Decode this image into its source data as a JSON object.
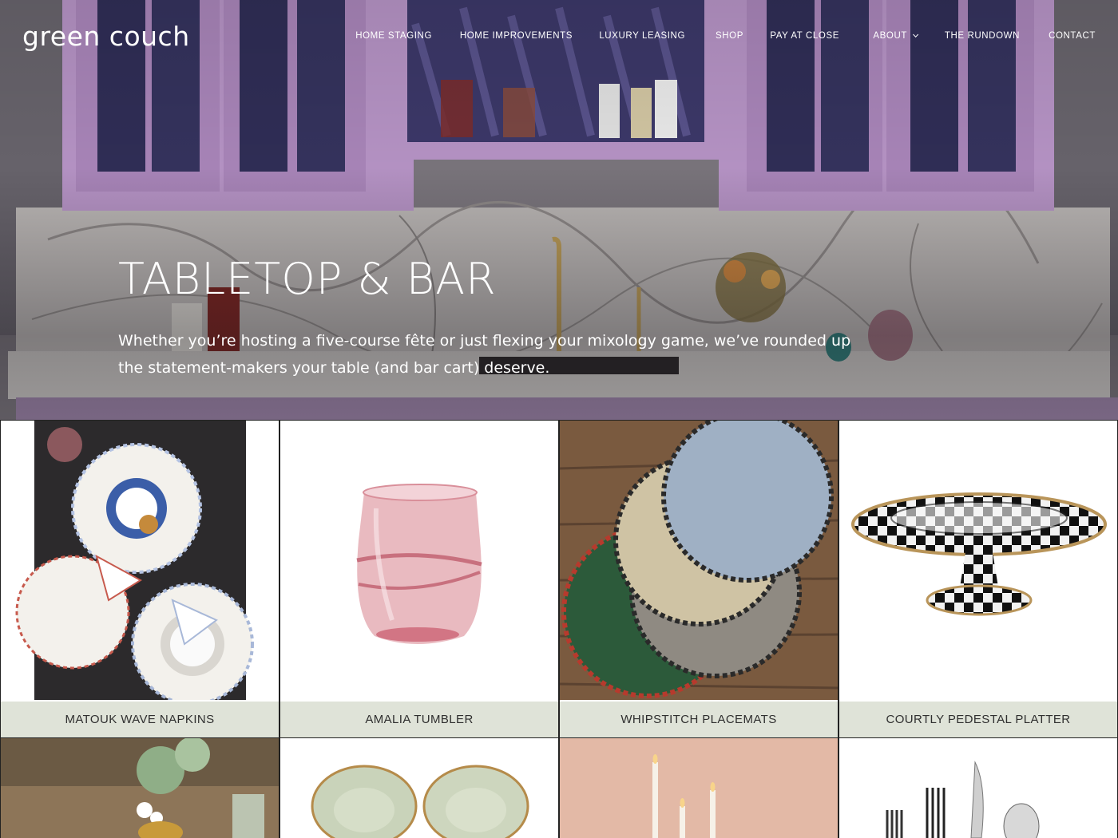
{
  "brand": {
    "logo_text": "green couch"
  },
  "nav": {
    "items": [
      {
        "label": "HOME STAGING"
      },
      {
        "label": "HOME IMPROVEMENTS"
      },
      {
        "label": "LUXURY LEASING"
      },
      {
        "label": "SHOP"
      },
      {
        "label": "PAY AT CLOSE"
      },
      {
        "label": "ABOUT",
        "has_dropdown": true
      },
      {
        "label": "THE RUNDOWN"
      },
      {
        "label": "CONTACT"
      }
    ]
  },
  "hero": {
    "title": "TABLETOP & BAR",
    "subtitle": "Whether you’re hosting a five-course fête or just flexing your mixology game, we’ve rounded up the statement-makers your table (and bar cart) deserve."
  },
  "products": [
    {
      "name": "MATOUK WAVE NAPKINS",
      "icon": "napkins-image"
    },
    {
      "name": "AMALIA TUMBLER",
      "icon": "tumbler-image"
    },
    {
      "name": "WHIPSTITCH PLACEMATS",
      "icon": "placemats-image"
    },
    {
      "name": "COURTLY PEDESTAL PLATTER",
      "icon": "platter-image"
    },
    {
      "name": "",
      "icon": "table-setting-image"
    },
    {
      "name": "",
      "icon": "plates-image"
    },
    {
      "name": "",
      "icon": "candles-image"
    },
    {
      "name": "",
      "icon": "flatware-image"
    }
  ],
  "colors": {
    "label_bg": "#dfe3d8",
    "cabinet": "#b592c4",
    "grid_border": "#222222"
  }
}
